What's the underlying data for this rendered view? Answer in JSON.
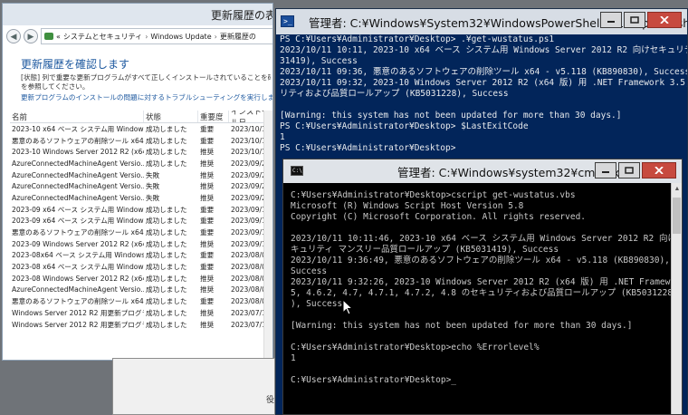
{
  "update_window": {
    "title": "更新履歴の表示",
    "address": {
      "root": "«",
      "crumbs": [
        "システムとセキュリティ",
        "Windows Update",
        "更新履歴の"
      ]
    },
    "heading": "更新履歴を確認します",
    "description": "[状態] 列で重要な更新プログラムがすべて正しくインストールされていることを確認してください。",
    "description2": "を参照してください。",
    "trouble_link": "更新プログラムのインストールの問題に対するトラブルシューティングを実行します",
    "columns": [
      "名前",
      "状態",
      "重要度",
      "インストール日"
    ],
    "rows": [
      [
        "2023-10 x64 ベース システム用 Windows...",
        "成功しました",
        "重要",
        "2023/10/11"
      ],
      [
        "悪意のあるソフトウェアの削除ツール x64 ...",
        "成功しました",
        "重要",
        "2023/10/11"
      ],
      [
        "2023-10 Windows Server 2012 R2 (x64 版) ...",
        "成功しました",
        "推奨",
        "2023/10/11"
      ],
      [
        "AzureConnectedMachineAgent Versio...",
        "成功しました",
        "推奨",
        "2023/09/20"
      ],
      [
        "AzureConnectedMachineAgent Versio...",
        "失敗",
        "推奨",
        "2023/09/20"
      ],
      [
        "AzureConnectedMachineAgent Versio...",
        "失敗",
        "推奨",
        "2023/09/20"
      ],
      [
        "AzureConnectedMachineAgent Versio...",
        "失敗",
        "推奨",
        "2023/09/20"
      ],
      [
        "2023-09 x64 ベース システム用 Windows...",
        "成功しました",
        "重要",
        "2023/09/13"
      ],
      [
        "2023-09 x64 ベース システム用 Windows...",
        "成功しました",
        "重要",
        "2023/09/13"
      ],
      [
        "悪意のあるソフトウェアの削除ツール x64 ...",
        "成功しました",
        "重要",
        "2023/09/13"
      ],
      [
        "2023-09 Windows Server 2012 R2 (x64 版) ...",
        "成功しました",
        "推奨",
        "2023/09/13"
      ],
      [
        "2023-08x64 ベース システム用 Windows...",
        "成功しました",
        "重要",
        "2023/08/09"
      ],
      [
        "2023-08 x64 ベース システム用 Windows...",
        "成功しました",
        "重要",
        "2023/08/09"
      ],
      [
        "2023-08 Windows Server 2012 R2 (x64 版) ...",
        "成功しました",
        "推奨",
        "2023/08/09"
      ],
      [
        "AzureConnectedMachineAgent Versio...",
        "成功しました",
        "推奨",
        "2023/08/09"
      ],
      [
        "悪意のあるソフトウェアの削除ツール x64 ...",
        "成功しました",
        "重要",
        "2023/08/09"
      ],
      [
        "Windows Server 2012 R2 用更新プログラ...",
        "成功しました",
        "推奨",
        "2023/07/13"
      ],
      [
        "Windows Server 2012 R2 用更新プログラ...",
        "成功しました",
        "推奨",
        "2023/07/13"
      ]
    ]
  },
  "bg_window": {
    "fragment": "役"
  },
  "powershell": {
    "title": "管理者: C:¥Windows¥System32¥WindowsPowerShell¥v1.0¥powershell.exe",
    "lines": [
      "PS C:¥Users¥Administrator¥Desktop> .¥get-wustatus.ps1",
      "2023/10/11 10:11, 2023-10 x64 ベース システム用 Windows Server 2012 R2 向けセキュリティ",
      "31419), Success",
      "2023/10/11 09:36, 悪意のあるソフトウェアの削除ツール x64 - v5.118 (KB890830), Success",
      "2023/10/11 09:32, 2023-10 Windows Server 2012 R2 (x64 版) 用 .NET Framework 3.5, 4.6.2,",
      "リティおよび品質ロールアップ (KB5031228), Success",
      "",
      "[Warning: this system has not been updated for more than 30 days.]",
      "PS C:¥Users¥Administrator¥Desktop> $LastExitCode",
      "1",
      "PS C:¥Users¥Administrator¥Desktop>"
    ]
  },
  "cmd": {
    "title": "管理者: C:¥Windows¥system32¥cmd.exe",
    "lines": [
      "C:¥Users¥Administrator¥Desktop>cscript get-wustatus.vbs",
      "Microsoft (R) Windows Script Host Version 5.8",
      "Copyright (C) Microsoft Corporation. All rights reserved.",
      "",
      "2023/10/11 10:11:46, 2023-10 x64 ベース システム用 Windows Server 2012 R2 向けセ",
      "キュリティ マンスリー品質ロールアップ (KB5031419), Success",
      "2023/10/11 9:36:49, 悪意のあるソフトウェアの削除ツール x64 - v5.118 (KB890830),",
      "Success",
      "2023/10/11 9:32:26, 2023-10 Windows Server 2012 R2 (x64 版) 用 .NET Framework 3.",
      "5, 4.6.2, 4.7, 4.7.1, 4.7.2, 4.8 のセキュリティおよび品質ロールアップ (KB5031228",
      "), Success",
      "",
      "[Warning: this system has not been updated for more than 30 days.]",
      "",
      "C:¥Users¥Administrator¥Desktop>echo %Errorlevel%",
      "1",
      "",
      "C:¥Users¥Administrator¥Desktop>_"
    ]
  }
}
